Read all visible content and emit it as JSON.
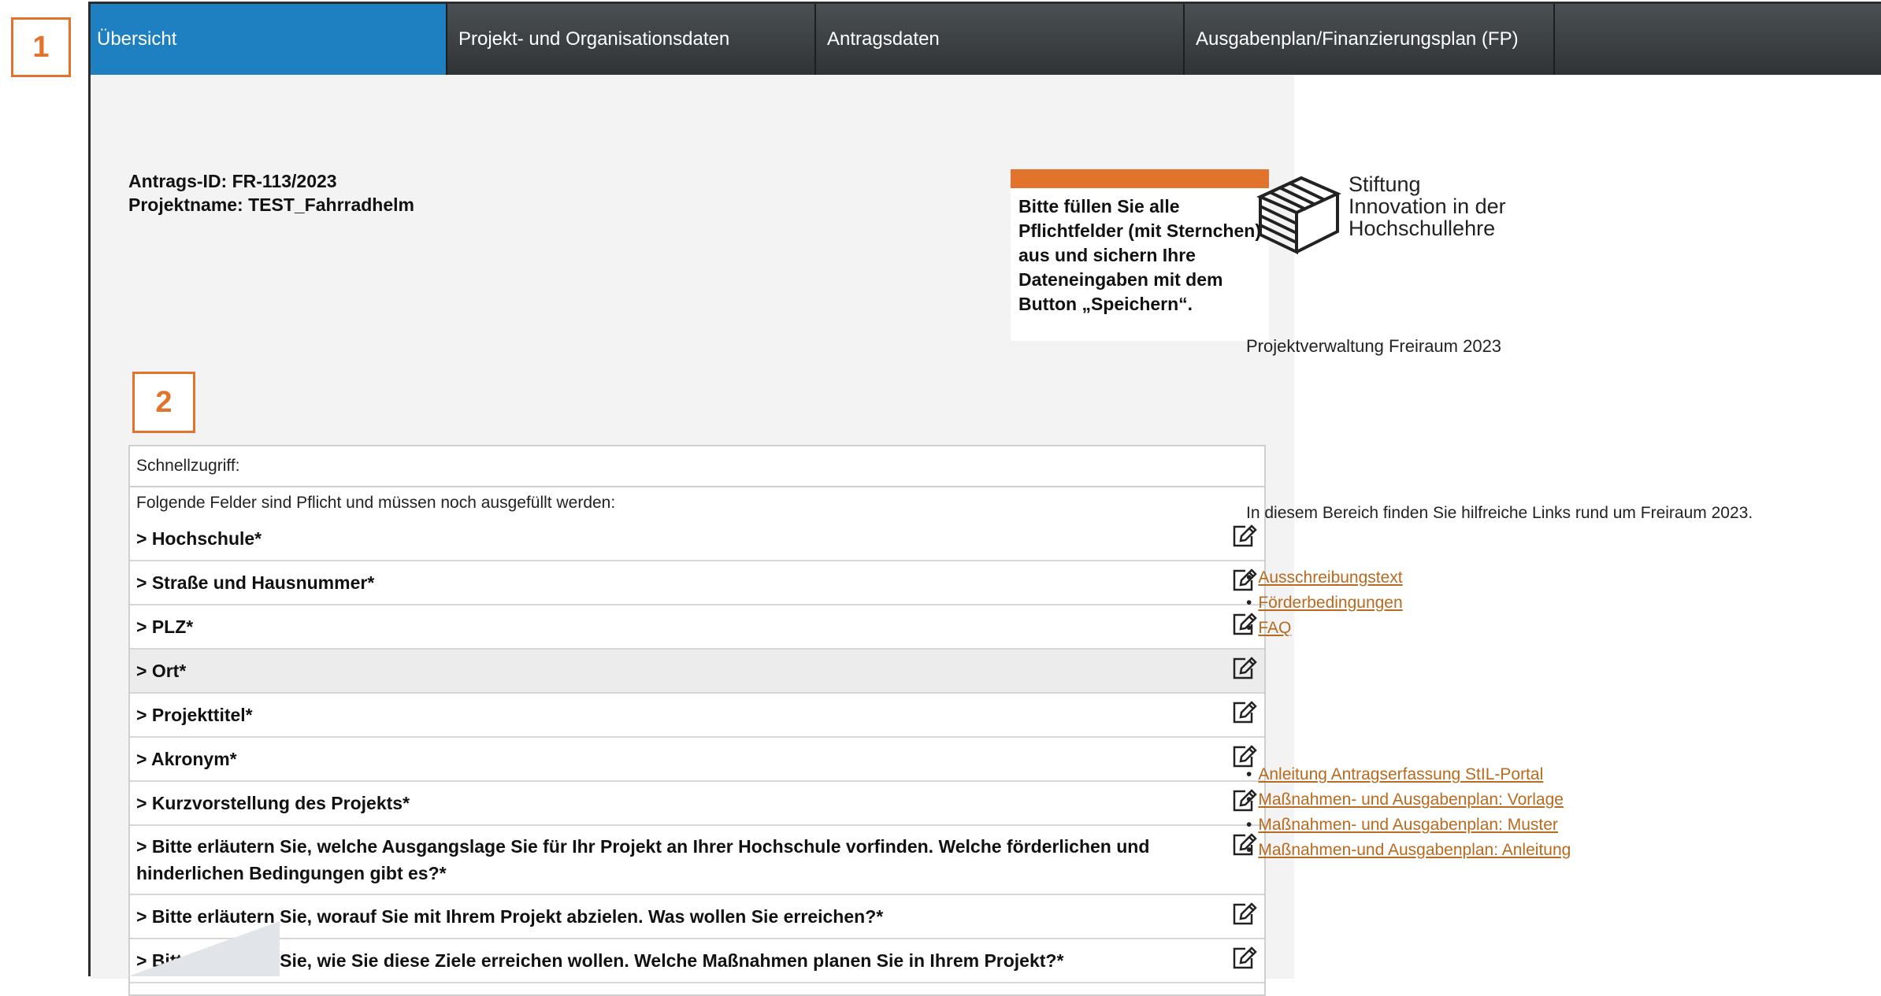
{
  "callouts": {
    "one": "1",
    "two": "2"
  },
  "tabs": [
    {
      "label": "Übersicht",
      "active": true
    },
    {
      "label": "Projekt- und Organisationsdaten",
      "active": false
    },
    {
      "label": "Antragsdaten",
      "active": false
    },
    {
      "label": "Ausgabenplan/Finanzierungsplan (FP)",
      "active": false
    }
  ],
  "application": {
    "id_line": "Antrags-ID: FR-113/2023",
    "name_line": "Projektname: TEST_Fahrradhelm"
  },
  "notice": {
    "text": "Bitte füllen Sie alle Pflichtfelder (mit Sternchen) aus und sichern Ihre Dateneingaben mit dem Button „Speichern“."
  },
  "quick_access": {
    "title": "Schnellzugriff:",
    "intro": "Folgende Felder sind Pflicht und müssen noch ausgefüllt werden:",
    "items": [
      {
        "label": "> Hochschule*"
      },
      {
        "label": "> Straße und Hausnummer*"
      },
      {
        "label": "> PLZ*"
      },
      {
        "label": "> Ort*"
      },
      {
        "label": "> Projekttitel*"
      },
      {
        "label": "> Akronym*"
      },
      {
        "label": "> Kurzvorstellung des Projekts*"
      },
      {
        "label": "> Bitte erläutern Sie, welche Ausgangslage Sie für Ihr Projekt an Ihrer Hochschule vorfinden. Welche förderlichen und hinderlichen Bedingungen gibt es?*"
      },
      {
        "label": "> Bitte erläutern Sie, worauf Sie mit Ihrem Projekt abzielen. Was wollen Sie erreichen?*"
      },
      {
        "label": "> Bitte erläutern Sie, wie Sie diese Ziele erreichen wollen. Welche Maßnahmen planen Sie in Ihrem Projekt?*"
      }
    ],
    "edit_icon": "edit-icon"
  },
  "sidebar": {
    "logo_line1": "Stiftung",
    "logo_line2": "Innovation in der",
    "logo_line3": "Hochschullehre",
    "subtitle": "Projektverwaltung Freiraum 2023",
    "info": "In diesem Bereich finden Sie hilfreiche Links rund um Freiraum 2023.",
    "links_primary": [
      "Ausschreibungstext",
      "Förderbedingungen",
      "FAQ"
    ],
    "links_secondary": [
      "Anleitung Antragserfassung StIL-Portal",
      "Maßnahmen- und Ausgabenplan: Vorlage",
      "Maßnahmen- und Ausgabenplan: Muster",
      "Maßnahmen-und Ausgabenplan: Anleitung"
    ]
  },
  "colors": {
    "accent_orange": "#e2732d",
    "active_tab": "#1e7fc1",
    "tabbar": "#3b3f42",
    "link": "#b86a1f"
  }
}
